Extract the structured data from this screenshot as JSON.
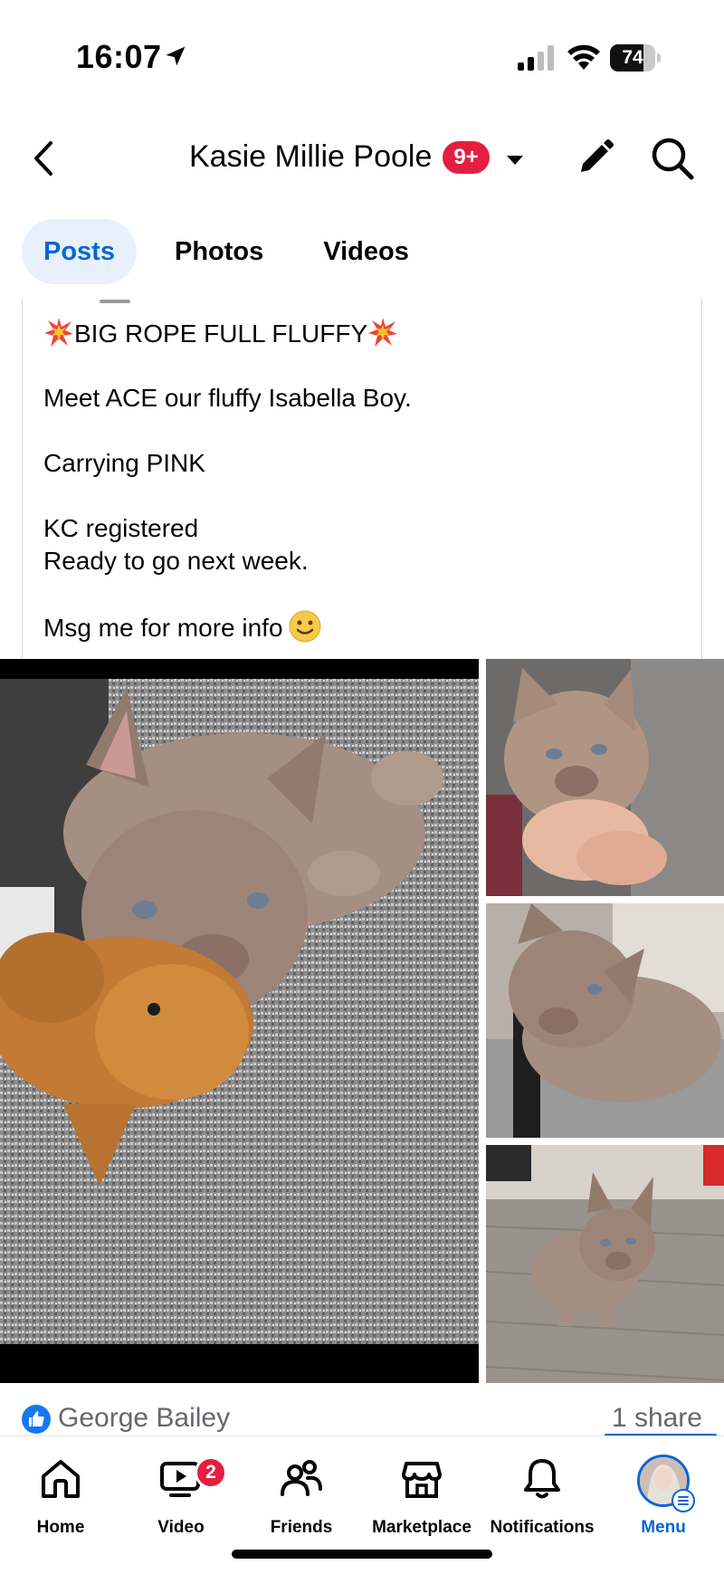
{
  "status_bar": {
    "time": "16:07",
    "battery_percent": "74",
    "battery_level": 0.74,
    "icons": [
      "location-arrow-icon",
      "signal-icon",
      "wifi-icon",
      "battery-icon"
    ]
  },
  "header": {
    "title": "Kasie Millie Poole",
    "notification_badge": "9+",
    "icons": [
      "back-chevron-icon",
      "caret-down-icon",
      "pencil-icon",
      "search-icon"
    ]
  },
  "tabs": [
    {
      "label": "Posts",
      "active": true
    },
    {
      "label": "Photos",
      "active": false
    },
    {
      "label": "Videos",
      "active": false
    }
  ],
  "post": {
    "headline": "BIG ROPE FULL FLUFFY",
    "line_meet": "Meet ACE our fluffy Isabella Boy.",
    "line_carrying": "Carrying PINK",
    "line_kc": "KC registered",
    "line_ready": "Ready to go next week.",
    "line_msg": "Msg me for more info",
    "emoji": [
      "collision-emoji",
      "slightly-smiling-face-emoji"
    ]
  },
  "photos": [
    {
      "name": "puppy-with-plush-toy"
    },
    {
      "name": "puppy-held-in-hand"
    },
    {
      "name": "puppy-lying-on-rug"
    },
    {
      "name": "puppy-standing-on-floor"
    }
  ],
  "reactions": {
    "reactor_name": "George Bailey",
    "shares": "1 share"
  },
  "bottom_nav": [
    {
      "label": "Home",
      "icon": "home-icon"
    },
    {
      "label": "Video",
      "icon": "video-icon",
      "badge": "2"
    },
    {
      "label": "Friends",
      "icon": "friends-icon"
    },
    {
      "label": "Marketplace",
      "icon": "marketplace-icon"
    },
    {
      "label": "Notifications",
      "icon": "bell-icon"
    },
    {
      "label": "Menu",
      "icon": "avatar",
      "active": true
    }
  ],
  "colors": {
    "accent": "#0a66d6",
    "badge": "#e41e3f",
    "tab_active_bg": "#e7f0fc",
    "secondary_text": "#65676b"
  }
}
